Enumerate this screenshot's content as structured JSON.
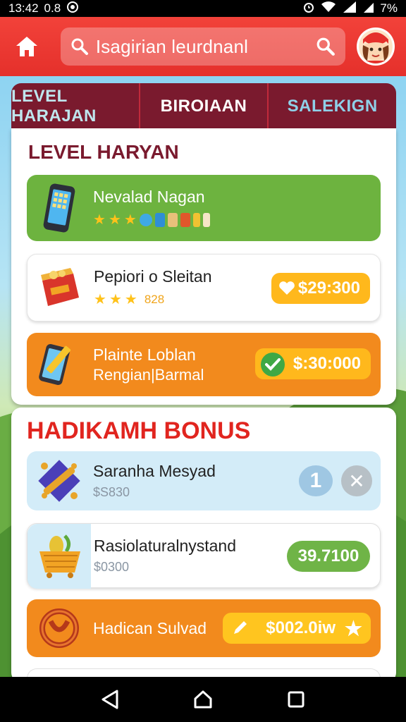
{
  "status_bar": {
    "time": "13:42",
    "extra": "0.8",
    "battery": "7%"
  },
  "search": {
    "text": "Isagirian leurdnanl"
  },
  "tabs": [
    {
      "label": "LEVEL HARAJAN"
    },
    {
      "label": "BIROIAAN"
    },
    {
      "label": "SALEKIGN"
    }
  ],
  "section1": {
    "title": "LEVEL HARYAN",
    "rows": [
      {
        "name": "Nevalad Nagan"
      },
      {
        "name": "Pepiori o Sleitan",
        "stars_label": "828",
        "price": "$29:300"
      },
      {
        "name": "Plainte Loblan",
        "sub": "Rengian|Barmal",
        "price": "$:30:000"
      }
    ]
  },
  "section2": {
    "title": "HADIKAMH BONUS",
    "rows": [
      {
        "name": "Saranha Mesyad",
        "sub": "$S830",
        "badge": "1"
      },
      {
        "name": "Rasiolaturalnystand",
        "sub": "$0300",
        "price": "39.7100"
      },
      {
        "name": "Hadican Sulvad",
        "price": "$002.0iw"
      }
    ]
  },
  "colors": {
    "appbar": "#e5302b",
    "tabs": "#7a1a2e",
    "green": "#6db33f",
    "orange": "#f28a1d",
    "gold": "#ffb81c"
  },
  "icons": [
    "home-icon",
    "search-icon",
    "avatar",
    "phone-icon",
    "treasure-box-icon",
    "tablet-pencil-icon",
    "scroll-icon",
    "basket-icon",
    "pretzel-icon",
    "back-icon",
    "home-nav-icon",
    "recents-icon"
  ]
}
